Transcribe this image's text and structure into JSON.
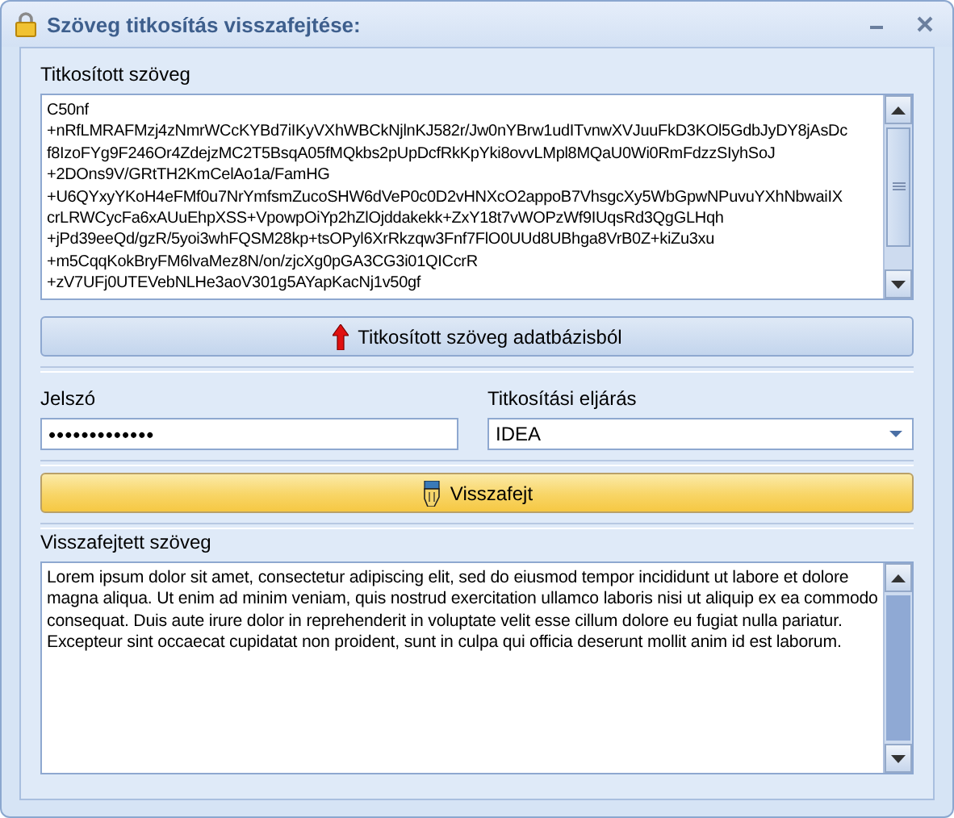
{
  "window": {
    "title": "Szöveg titkosítás visszafejtése:"
  },
  "encrypted": {
    "label": "Titkosított szöveg",
    "lines": [
      "C50nf",
      "+nRfLMRAFMzj4zNmrWCcKYBd7iIKyVXhWBCkNjlnKJ582r/Jw0nYBrw1udITvnwXVJuuFkD3KOl5GdbJyDY8jAsDc",
      "f8IzoFYg9F246Or4ZdejzMC2T5BsqA05fMQkbs2pUpDcfRkKpYki8ovvLMpl8MQaU0Wi0RmFdzzSIyhSoJ",
      "+2DOns9V/GRtTH2KmCelAo1a/FamHG",
      "+U6QYxyYKoH4eFMf0u7NrYmfsmZucoSHW6dVeP0c0D2vHNXcO2appoB7VhsgcXy5WbGpwNPuvuYXhNbwaiIX",
      "crLRWCycFa6xAUuEhpXSS+VpowpOiYp2hZlOjddakekk+ZxY18t7vWOPzWf9IUqsRd3QgGLHqh",
      "+jPd39eeQd/gzR/5yoi3whFQSM28kp+tsOPyl6XrRkzqw3Fnf7FlO0UUd8UBhga8VrB0Z+kiZu3xu",
      "+m5CqqKokBryFM6lvaMez8N/on/zjcXg0pGA3CG3i01QICcrR",
      "+zV7UFj0UTEVebNLHe3aoV301g5AYapKacNj1v50gf"
    ]
  },
  "load_button": {
    "label": "Titkosított szöveg adatbázisból"
  },
  "password": {
    "label": "Jelszó",
    "value": "•••••••••••••"
  },
  "method": {
    "label": "Titkosítási eljárás",
    "value": "IDEA"
  },
  "decrypt_button": {
    "label": "Visszafejt"
  },
  "decrypted": {
    "label": "Visszafejtett szöveg",
    "text": "Lorem ipsum dolor sit amet, consectetur adipiscing elit, sed do eiusmod tempor incididunt ut labore et dolore magna aliqua. Ut enim ad minim veniam, quis nostrud exercitation ullamco laboris nisi ut aliquip ex ea commodo consequat. Duis aute irure dolor in reprehenderit in voluptate velit esse cillum dolore eu fugiat nulla pariatur. Excepteur sint occaecat cupidatat non proident, sunt in culpa qui officia deserunt mollit anim id est laborum."
  }
}
